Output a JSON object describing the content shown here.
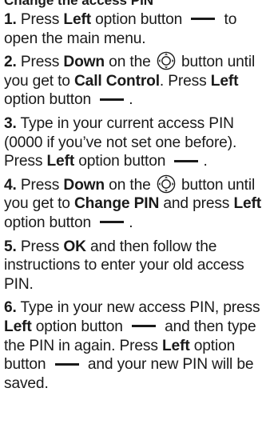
{
  "heading": "Change the access PIN",
  "steps": [
    {
      "num": "1.",
      "parts": [
        {
          "t": "text",
          "v": "Press "
        },
        {
          "t": "kw",
          "v": "Left"
        },
        {
          "t": "text",
          "v": " option button "
        },
        {
          "t": "dash"
        },
        {
          "t": "text",
          "v": " to open the main menu."
        }
      ]
    },
    {
      "num": "2.",
      "parts": [
        {
          "t": "text",
          "v": "Press "
        },
        {
          "t": "kw",
          "v": "Down"
        },
        {
          "t": "text",
          "v": " on the "
        },
        {
          "t": "icon"
        },
        {
          "t": "text",
          "v": " button until you get to "
        },
        {
          "t": "kw",
          "v": "Call Control"
        },
        {
          "t": "text",
          "v": ". Press "
        },
        {
          "t": "kw",
          "v": "Left"
        },
        {
          "t": "text",
          "v": " option button "
        },
        {
          "t": "dash"
        },
        {
          "t": "text",
          "v": "."
        }
      ]
    },
    {
      "num": "3.",
      "parts": [
        {
          "t": "text",
          "v": "Type in your current access PIN (0000 if you’ve not set one before). Press "
        },
        {
          "t": "kw",
          "v": "Left"
        },
        {
          "t": "text",
          "v": " option button "
        },
        {
          "t": "dash"
        },
        {
          "t": "text",
          "v": "."
        }
      ]
    },
    {
      "num": "4.",
      "parts": [
        {
          "t": "text",
          "v": "Press "
        },
        {
          "t": "kw",
          "v": "Down"
        },
        {
          "t": "text",
          "v": " on the "
        },
        {
          "t": "icon"
        },
        {
          "t": "text",
          "v": " button until you get to "
        },
        {
          "t": "kw",
          "v": "Change PIN"
        },
        {
          "t": "text",
          "v": " and press "
        },
        {
          "t": "kw",
          "v": "Left"
        },
        {
          "t": "text",
          "v": " option button "
        },
        {
          "t": "dash"
        },
        {
          "t": "text",
          "v": "."
        }
      ]
    },
    {
      "num": "5.",
      "parts": [
        {
          "t": "text",
          "v": "Press "
        },
        {
          "t": "kw",
          "v": "OK"
        },
        {
          "t": "text",
          "v": " and then follow the instructions to enter your old access PIN."
        }
      ]
    },
    {
      "num": "6.",
      "parts": [
        {
          "t": "text",
          "v": "Type in your new access PIN, press "
        },
        {
          "t": "kw",
          "v": "Left"
        },
        {
          "t": "text",
          "v": " option button "
        },
        {
          "t": "dash"
        },
        {
          "t": "text",
          "v": " and then type the PIN in again. Press "
        },
        {
          "t": "kw",
          "v": "Left"
        },
        {
          "t": "text",
          "v": " option button "
        },
        {
          "t": "dash"
        },
        {
          "t": "text",
          "v": " and your new PIN will be saved."
        }
      ]
    }
  ]
}
